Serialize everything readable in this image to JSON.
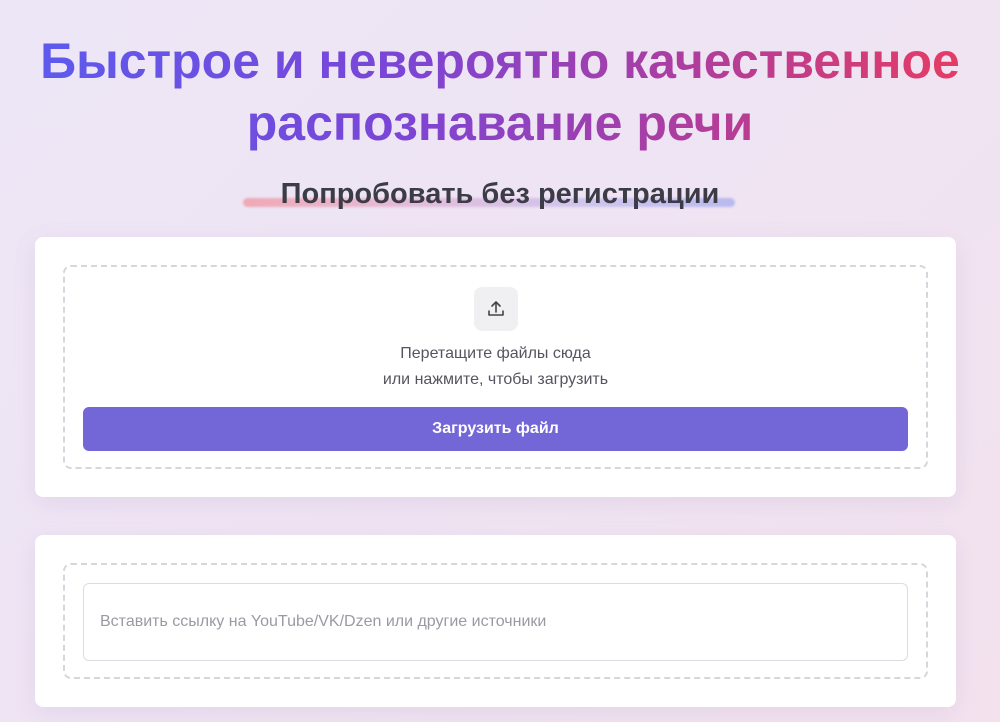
{
  "hero": {
    "title_line1": "Быстрое и невероятно качественное",
    "title_line2": "распознавание речи",
    "gradient_colors": [
      "#5a5cf0",
      "#7b45d6",
      "#b03d9c",
      "#ee3b5c"
    ]
  },
  "subtitle": "Попробовать без регистрации",
  "upload": {
    "icon": "upload-icon",
    "drop_line1": "Перетащите файлы сюда",
    "drop_line2": "или нажмите, чтобы загрузить",
    "button_label": "Загрузить файл",
    "button_color": "#7367d8"
  },
  "link": {
    "value": "",
    "placeholder": "Вставить ссылку на YouTube/VK/Dzen или другие источники"
  }
}
